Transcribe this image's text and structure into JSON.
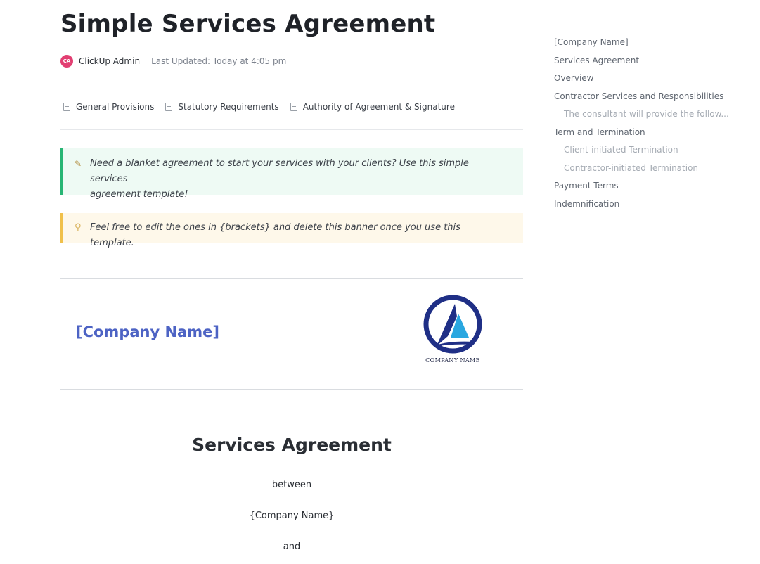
{
  "document": {
    "title": "Simple Services Agreement",
    "author": {
      "initials": "CA",
      "name": "ClickUp Admin",
      "avatar_color": "#e23f72"
    },
    "last_updated": "Last Updated: Today at 4:05 pm"
  },
  "subpages": [
    {
      "label": "General Provisions",
      "icon": "document-icon"
    },
    {
      "label": "Statutory Requirements",
      "icon": "document-icon"
    },
    {
      "label": "Authority of Agreement & Signature",
      "icon": "document-icon"
    }
  ],
  "callouts": {
    "green": {
      "icon": "memo-icon",
      "line1": "Need a blanket agreement to start your services with your clients? Use this simple services",
      "line2": "agreement template!",
      "accent": "#27b574",
      "background": "#eefaf4"
    },
    "yellow": {
      "icon": "lightbulb-icon",
      "text": "Feel free to edit the ones in {brackets} and delete this banner once you use this template.",
      "accent": "#f0c04a",
      "background": "#fef8ea"
    }
  },
  "company_header": {
    "name": "[Company Name]",
    "name_color": "#4d63c4",
    "logo_caption": "COMPANY NAME"
  },
  "agreement": {
    "title": "Services Agreement",
    "lines": [
      "between",
      "{Company Name}",
      "and"
    ]
  },
  "table_of_contents": [
    {
      "label": "[Company Name]",
      "level": 1
    },
    {
      "label": "Services Agreement",
      "level": 1
    },
    {
      "label": "Overview",
      "level": 1
    },
    {
      "label": "Contractor Services and Responsibilities",
      "level": 1
    },
    {
      "label": "The consultant will provide the follow...",
      "level": 2
    },
    {
      "label": "Term and Termination",
      "level": 1
    },
    {
      "label": "Client-initiated Termination",
      "level": 2
    },
    {
      "label": "Contractor-initiated Termination",
      "level": 2
    },
    {
      "label": "Payment Terms",
      "level": 1
    },
    {
      "label": "Indemnification",
      "level": 1
    }
  ]
}
